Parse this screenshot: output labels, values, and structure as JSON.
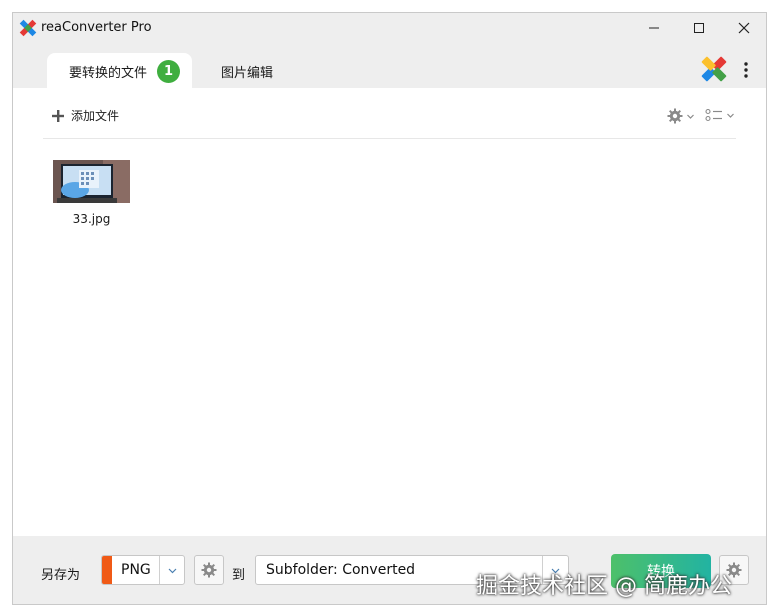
{
  "window": {
    "title": "reaConverter Pro",
    "controls": [
      "minimize-icon",
      "maximize-icon",
      "close-icon"
    ]
  },
  "tabs": [
    {
      "label": "要转换的文件",
      "badge": "1",
      "active": true
    },
    {
      "label": "图片编辑",
      "active": false
    }
  ],
  "toolbar": {
    "add_files_label": "添加文件",
    "right_icons": [
      "gear-icon",
      "chevron-down-icon",
      "list-view-icon",
      "chevron-down-icon"
    ]
  },
  "files": [
    {
      "name": "33.jpg",
      "icon": "image-thumbnail"
    }
  ],
  "bottom": {
    "save_as_label": "另存为",
    "format": {
      "value": "PNG",
      "swatch_color": "#f05a16"
    },
    "to_label": "到",
    "destination": {
      "value": "Subfolder: Converted"
    },
    "convert_label": "转换"
  },
  "watermark": "掘金技术社区 @ 简鹿办公",
  "colors": {
    "badge": "#3fae3f",
    "convert_gradient_start": "#4dc06a",
    "convert_gradient_end": "#22b3a2",
    "format_swatch": "#f05a16"
  }
}
